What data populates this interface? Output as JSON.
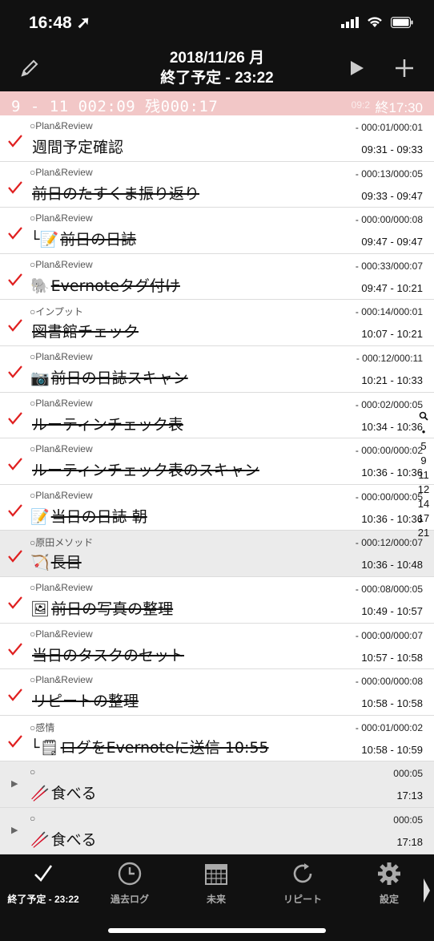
{
  "status": {
    "time": "16:48"
  },
  "header": {
    "date": "2018/11/26 月",
    "subtitle": "終了予定 - 23:22"
  },
  "summary": {
    "left": "9 - 11   002:09 残000:17",
    "ghost": "09:2",
    "right": "終17:30"
  },
  "rows": [
    {
      "category": "Plan&Review",
      "durations": "- 000:01/000:01",
      "title": "週間予定確認",
      "emoji": "",
      "times": "09:31 - 09:33",
      "done": false,
      "highlight": false
    },
    {
      "category": "Plan&Review",
      "durations": "- 000:13/000:05",
      "title": "前日のたすくま振り返り",
      "emoji": "",
      "times": "09:33 - 09:47",
      "done": true,
      "highlight": false
    },
    {
      "category": "Plan&Review",
      "durations": "- 000:00/000:08",
      "title": "前日の日誌",
      "emoji": "└📝",
      "times": "09:47 - 09:47",
      "done": true,
      "highlight": false
    },
    {
      "category": "Plan&Review",
      "durations": "- 000:33/000:07",
      "title": "Evernoteタグ付け",
      "emoji": "🐘",
      "times": "09:47 - 10:21",
      "done": true,
      "highlight": false
    },
    {
      "category": "インプット",
      "durations": "- 000:14/000:01",
      "title": "図書館チェック",
      "emoji": "",
      "times": "10:07 - 10:21",
      "done": true,
      "highlight": false
    },
    {
      "category": "Plan&Review",
      "durations": "- 000:12/000:11",
      "title": "前日の日誌スキャン",
      "emoji": "📷",
      "times": "10:21 - 10:33",
      "done": true,
      "highlight": false
    },
    {
      "category": "Plan&Review",
      "durations": "- 000:02/000:05",
      "title": "ルーティンチェック表",
      "emoji": "",
      "times": "10:34 - 10:36",
      "done": true,
      "highlight": false
    },
    {
      "category": "Plan&Review",
      "durations": "- 000:00/000:02",
      "title": "ルーティンチェック表のスキャン",
      "emoji": "",
      "times": "10:36 - 10:36",
      "done": true,
      "highlight": false
    },
    {
      "category": "Plan&Review",
      "durations": "- 000:00/000:05",
      "title": "当日の日誌 朝",
      "emoji": "📝",
      "times": "10:36 - 10:36",
      "done": true,
      "highlight": false
    },
    {
      "category": "原田メソッド",
      "durations": "- 000:12/000:07",
      "title": "長目",
      "emoji": "🏹",
      "times": "10:36 - 10:48",
      "done": true,
      "highlight": true
    },
    {
      "category": "Plan&Review",
      "durations": "- 000:08/000:05",
      "title": "前日の写真の整理",
      "emoji": "🖼",
      "times": "10:49 - 10:57",
      "done": true,
      "highlight": false
    },
    {
      "category": "Plan&Review",
      "durations": "- 000:00/000:07",
      "title": "当日のタスクのセット",
      "emoji": "",
      "times": "10:57 - 10:58",
      "done": true,
      "highlight": false
    },
    {
      "category": "Plan&Review",
      "durations": "- 000:00/000:08",
      "title": "リピートの整理",
      "emoji": "",
      "times": "10:58 - 10:58",
      "done": true,
      "highlight": false
    },
    {
      "category": "感情",
      "durations": "- 000:01/000:02",
      "title": "ログをEvernoteに送信 10:55",
      "emoji": "└🗒",
      "times": "10:58 - 10:59",
      "done": true,
      "highlight": false
    }
  ],
  "future_rows": [
    {
      "category": "",
      "durations": "000:05",
      "title": "食べる",
      "emoji": "🥢",
      "times": "17:13"
    },
    {
      "category": "",
      "durations": "000:05",
      "title": "食べる",
      "emoji": "🥢",
      "times": "17:18"
    }
  ],
  "index_bar": [
    "5",
    "9",
    "11",
    "12",
    "14",
    "17",
    "21"
  ],
  "tabs": [
    {
      "label": "終了予定 - 23:22",
      "icon": "check-icon"
    },
    {
      "label": "過去ログ",
      "icon": "clock-icon"
    },
    {
      "label": "未来",
      "icon": "calendar-icon"
    },
    {
      "label": "リピート",
      "icon": "repeat-icon"
    },
    {
      "label": "設定",
      "icon": "gear-icon"
    }
  ],
  "colors": {
    "check": "#e02020",
    "summary_bg": "#f2c7c7",
    "bar_bg": "#111111"
  }
}
